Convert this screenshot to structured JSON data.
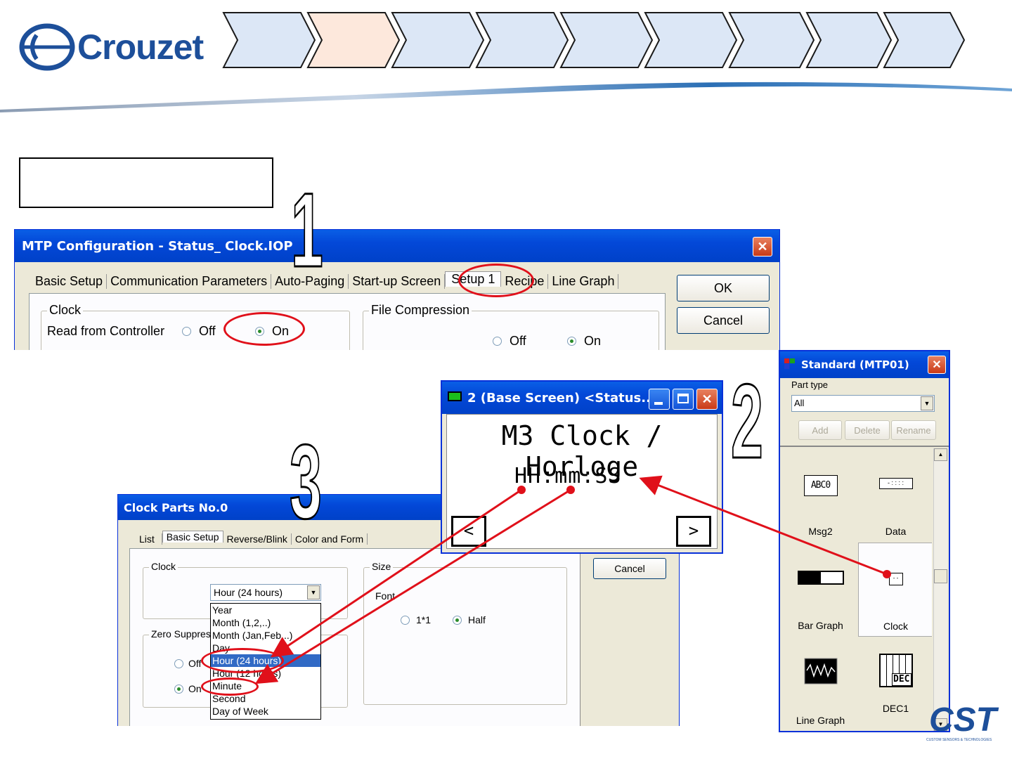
{
  "brand": {
    "logo_text": "Crouzet",
    "corner_logo_text": "CST",
    "corner_logo_tagline": "CUSTOM SENSORS & TECHNOLOGIES"
  },
  "steps": {
    "num1": "1",
    "num2": "2",
    "num3": "3"
  },
  "colors": {
    "accent_red": "#e0101a",
    "chevron_blue": "#dce7f6",
    "chevron_active": "#fde8dc",
    "xp_title": "#0348d8",
    "xp_face": "#ece9d8"
  },
  "mtp_config": {
    "title": "MTP Configuration - Status_ Clock.IOP",
    "tabs": [
      "Basic Setup",
      "Communication Parameters",
      "Auto-Paging",
      "Start-up Screen",
      "Setup 1",
      "Recipe",
      "Line Graph"
    ],
    "active_tab": "Setup 1",
    "ok_label": "OK",
    "cancel_label": "Cancel",
    "clock_group": "Clock",
    "read_from_controller": "Read from Controller",
    "off_label": "Off",
    "on_label": "On",
    "file_compression_group": "File Compression",
    "fc_off": "Off",
    "fc_on": "On"
  },
  "base_screen": {
    "title": "2 (Base Screen) <Status...",
    "heading": "M3 Clock / Horloge",
    "clock_format": "HH:mm:SS",
    "prev_label": "<",
    "next_label": ">"
  },
  "standard_panel": {
    "title": "Standard (MTP01)",
    "part_type_label": "Part type",
    "part_type_value": "All",
    "add_label": "Add",
    "delete_label": "Delete",
    "rename_label": "Rename",
    "parts": [
      {
        "name": "Msg2",
        "icon": "msg-icon",
        "icon_text": "ABC0"
      },
      {
        "name": "Data",
        "icon": "data-icon",
        "icon_text": "- : : : :"
      },
      {
        "name": "Bar Graph",
        "icon": "bar-graph-icon",
        "icon_text": ""
      },
      {
        "name": "Clock",
        "icon": "clock-icon",
        "icon_text": "- -"
      },
      {
        "name": "Line Graph",
        "icon": "line-graph-icon",
        "icon_text": ""
      },
      {
        "name": "DEC1",
        "icon": "dec-icon",
        "icon_text": "DEC"
      }
    ]
  },
  "clock_parts": {
    "title": "Clock Parts No.0",
    "tabs": [
      "List",
      "Basic Setup",
      "Reverse/Blink",
      "Color and Form"
    ],
    "active_tab": "Basic Setup",
    "cancel_label": "Cancel",
    "clock_group": "Clock",
    "selected": "Hour  (24 hours)",
    "options": [
      "Year",
      "Month  (1,2,..)",
      "Month  (Jan,Feb,..)",
      "Day",
      "Hour  (24 hours)",
      "Hour  (12 hours)",
      "Minute",
      "Second",
      "Day of Week"
    ],
    "highlighted_option": "Hour  (24 hours)",
    "zero_suppress_group": "Zero Suppress",
    "zs_off": "Off",
    "zs_on": "On",
    "size_group": "Size",
    "font_label": "Font",
    "font_1x1": "1*1",
    "font_half": "Half"
  }
}
